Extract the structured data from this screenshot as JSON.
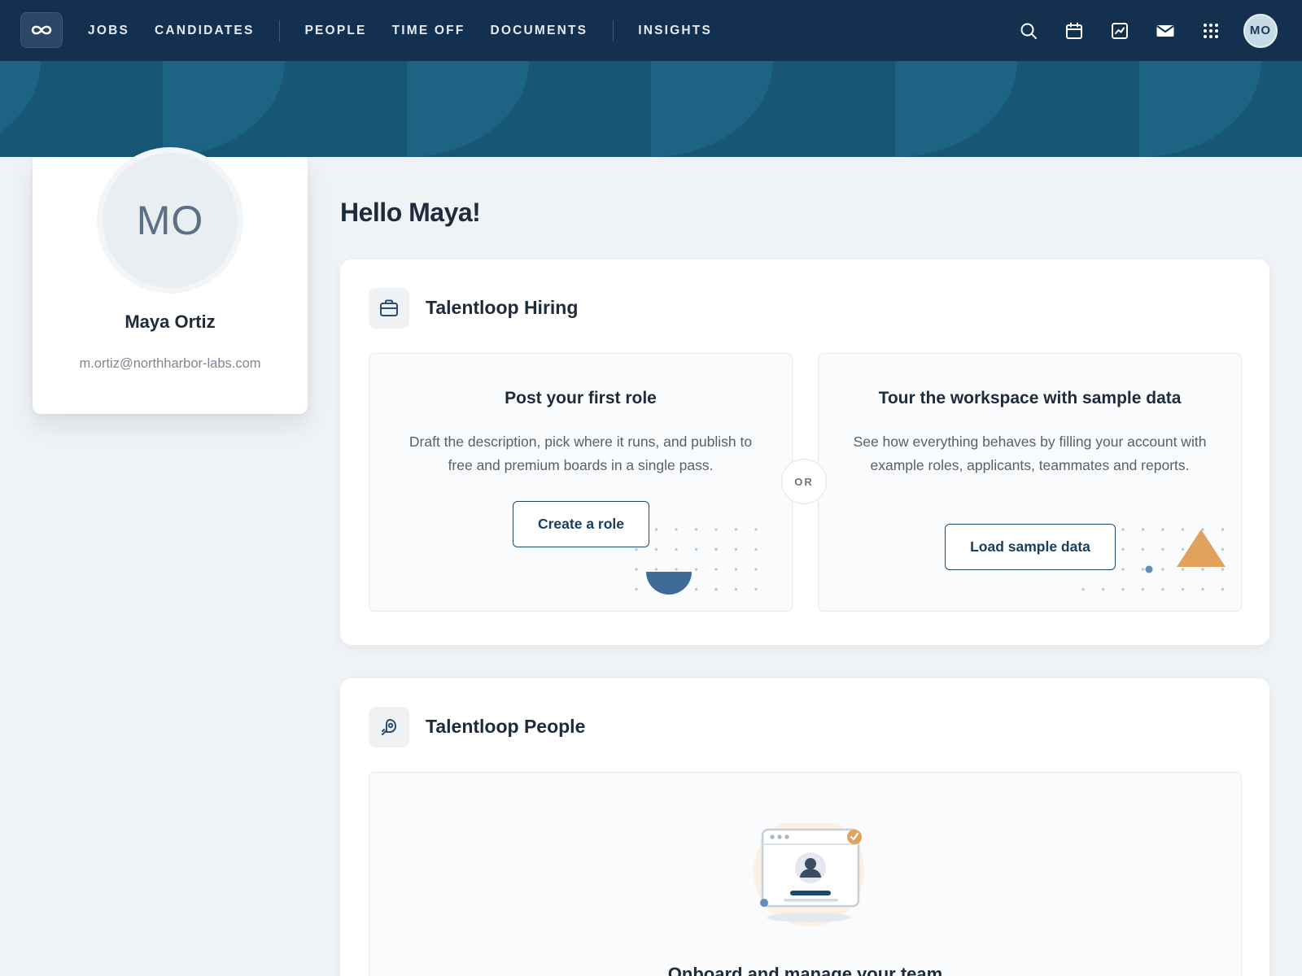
{
  "nav": {
    "logo_icon": "infinity-icon",
    "links": [
      "JOBS",
      "CANDIDATES",
      "PEOPLE",
      "TIME OFF",
      "DOCUMENTS",
      "INSIGHTS"
    ],
    "icons": [
      "search-icon",
      "calendar-icon",
      "chart-icon",
      "mail-icon",
      "apps-grid-icon"
    ],
    "avatar_initials": "MO"
  },
  "profile": {
    "initials": "MO",
    "name": "Maya Ortiz",
    "email": "m.ortiz@northharbor-labs.com"
  },
  "greeting": "Hello Maya!",
  "hiring": {
    "icon": "briefcase-icon",
    "title": "Talentloop Hiring",
    "option_left": {
      "title": "Post your first role",
      "description": "Draft the description, pick where it runs, and publish to free and premium boards in a single pass.",
      "button": "Create a role"
    },
    "or_label": "OR",
    "option_right": {
      "title": "Tour the workspace with sample data",
      "description": "See how everything behaves by filling your account with example roles, applicants, teammates and reports.",
      "button": "Load sample data"
    }
  },
  "people": {
    "icon": "rocket-icon",
    "title": "Talentloop People",
    "onboard_title": "Onboard and manage your team"
  },
  "colors": {
    "nav_bg": "#13304f",
    "banner_light": "#1c6384",
    "banner_dark": "#185675",
    "accent_orange": "#e2a15c",
    "accent_blue": "#3e6b97",
    "button_border": "#1c4a6d"
  }
}
